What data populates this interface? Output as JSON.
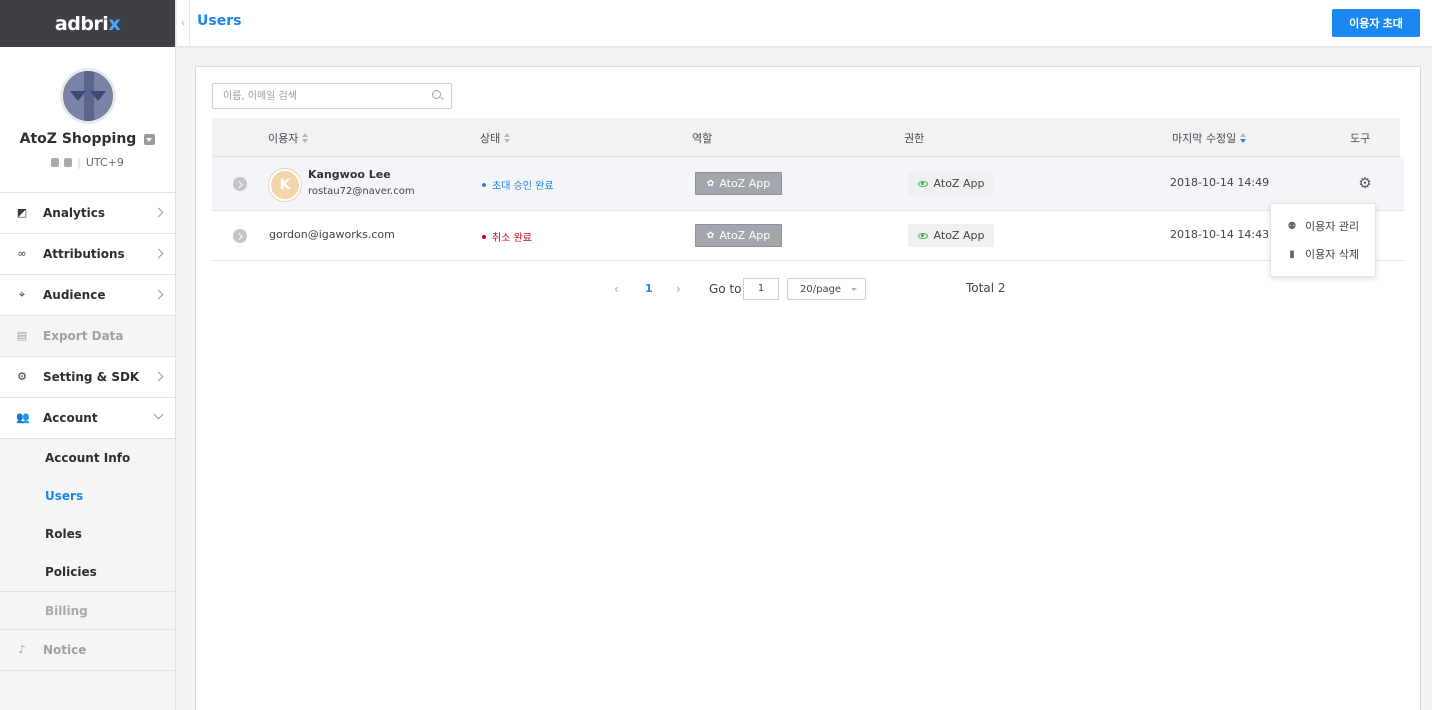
{
  "brand": {
    "logo_main": "adbri",
    "logo_x": "x"
  },
  "profile": {
    "org_name": "AtoZ Shopping",
    "timezone": "UTC+9"
  },
  "nav": {
    "analytics": "Analytics",
    "attributions": "Attributions",
    "audience": "Audience",
    "export_data": "Export Data",
    "setting_sdk": "Setting & SDK",
    "account": "Account",
    "account_sub": [
      "Account Info",
      "Users",
      "Roles",
      "Policies",
      "Billing"
    ],
    "notice": "Notice"
  },
  "header": {
    "title": "Users",
    "invite_label": "이용자 초대"
  },
  "search": {
    "placeholder": "이름, 이메일 검색"
  },
  "table": {
    "columns": {
      "user": "이용자",
      "status": "상태",
      "role": "역할",
      "permission": "권한",
      "last_modified": "마지막 수정일",
      "tools": "도구"
    },
    "rows": [
      {
        "avatar_initial": "K",
        "name": "Kangwoo Lee",
        "email": "rostau72@naver.com",
        "status": "초대 승인 완료",
        "role": "AtoZ App",
        "permission": "AtoZ App",
        "date": "2018-10-14 14:49"
      },
      {
        "email": "gordon@igaworks.com",
        "status": "취소 완료",
        "role": "AtoZ App",
        "permission": "AtoZ App",
        "date": "2018-10-14 14:43"
      }
    ]
  },
  "tools_menu": {
    "manage": "이용자 관리",
    "delete": "이용자 삭제"
  },
  "pagination": {
    "prev": "‹",
    "current": "1",
    "next": "›",
    "goto_label": "Go to",
    "goto_value": "1",
    "per_page": "20/page",
    "total": "Total 2"
  },
  "colors": {
    "accent": "#1e86e6",
    "button": "#1a88f0",
    "sidebar_header": "#3f4046",
    "status_ok": "#1e86e6",
    "status_cancel": "#d0021b",
    "permission_eye": "#3cb94e"
  },
  "icons": {
    "analytics": "chart-icon",
    "attributions": "infinity-icon",
    "audience": "crosshair-icon",
    "export_data": "file-icon",
    "setting_sdk": "gear-icon",
    "account": "users-icon",
    "notice": "bell-icon"
  }
}
